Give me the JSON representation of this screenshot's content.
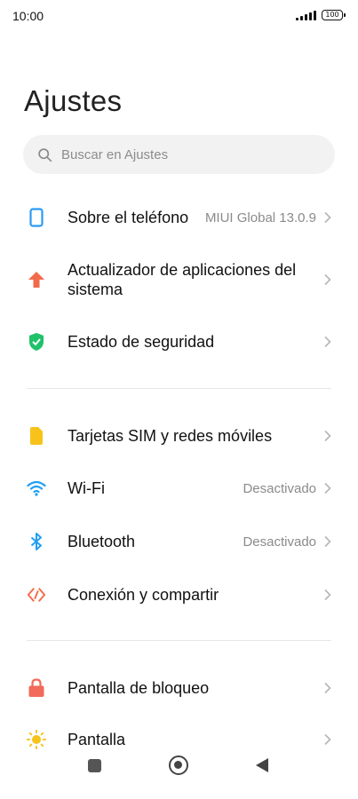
{
  "status_bar": {
    "time": "10:00",
    "battery": "100"
  },
  "page": {
    "title": "Ajustes"
  },
  "search": {
    "placeholder": "Buscar en Ajustes",
    "icon": "search-icon"
  },
  "items": [
    {
      "label": "Sobre el teléfono",
      "value": "MIUI Global 13.0.9",
      "icon": "phone-icon",
      "color": "#2b9af3"
    },
    {
      "label": "Actualizador de aplicaciones del sistema",
      "value": "",
      "icon": "arrow-up-icon",
      "color": "#f26a4b"
    },
    {
      "label": "Estado de seguridad",
      "value": "",
      "icon": "shield-check-icon",
      "color": "#1fc16b"
    },
    {
      "label": "Tarjetas SIM y redes móviles",
      "value": "",
      "icon": "sim-card-icon",
      "color": "#f7c21a"
    },
    {
      "label": "Wi-Fi",
      "value": "Desactivado",
      "icon": "wifi-icon",
      "color": "#1f9ff5"
    },
    {
      "label": "Bluetooth",
      "value": "Desactivado",
      "icon": "bluetooth-icon",
      "color": "#1f9ff5"
    },
    {
      "label": "Conexión y compartir",
      "value": "",
      "icon": "connection-share-icon",
      "color": "#f2714f"
    },
    {
      "label": "Pantalla de bloqueo",
      "value": "",
      "icon": "lock-icon",
      "color": "#f26a5a"
    },
    {
      "label": "Pantalla",
      "value": "",
      "icon": "sun-icon",
      "color": "#f7c21a"
    }
  ],
  "nav": {
    "recents": "recents-square-icon",
    "home": "home-circle-icon",
    "back": "back-triangle-icon"
  }
}
